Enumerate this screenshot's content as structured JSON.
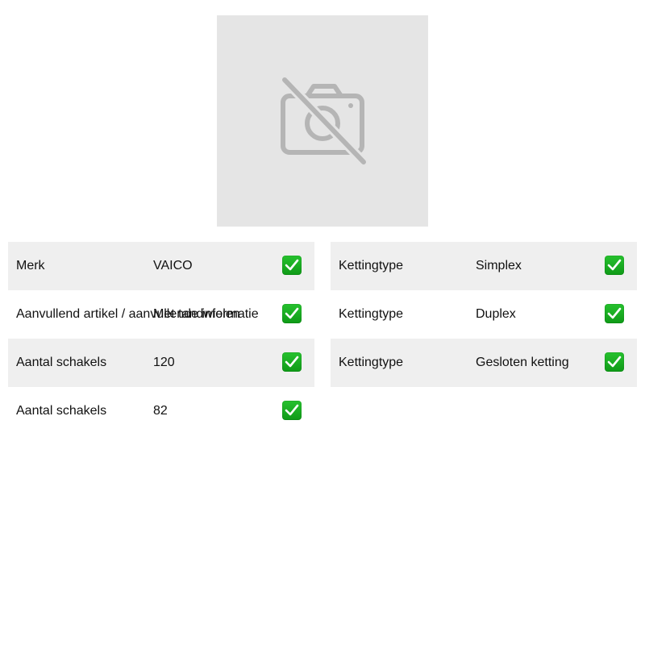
{
  "image": {
    "icon": "camera-off-icon",
    "background": "#e5e5e5"
  },
  "left_table": [
    {
      "label": "Merk",
      "value": "VAICO",
      "check": "check-icon"
    },
    {
      "label": "Aanvullend artikel / aanvullende informatie",
      "value": "Met tandwielen",
      "check": "check-icon"
    },
    {
      "label": "Aantal schakels",
      "value": "120",
      "check": "check-icon"
    },
    {
      "label": "Aantal schakels",
      "value": "82",
      "check": "check-icon"
    }
  ],
  "right_table": [
    {
      "label": "Kettingtype",
      "value": "Simplex",
      "check": "check-icon"
    },
    {
      "label": "Kettingtype",
      "value": "Duplex",
      "check": "check-icon"
    },
    {
      "label": "Kettingtype",
      "value": "Gesloten ketting",
      "check": "check-icon"
    }
  ],
  "colors": {
    "row_shade": "#efefef",
    "check_green": "#1fae26"
  }
}
